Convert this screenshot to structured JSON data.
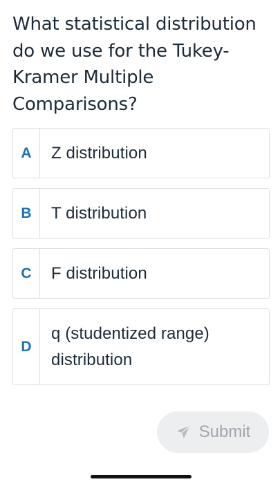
{
  "question": {
    "text": "What statistical distribution do we use for the Tukey-Kramer Multiple Comparisons?"
  },
  "options": [
    {
      "letter": "A",
      "text": "Z distribution"
    },
    {
      "letter": "B",
      "text": "T distribution"
    },
    {
      "letter": "C",
      "text": "F distribution"
    },
    {
      "letter": "D",
      "text": "q (studentized range) distribution"
    }
  ],
  "submit": {
    "label": "Submit",
    "icon": "paper-plane-icon",
    "state": "disabled"
  },
  "colors": {
    "letter_accent": "#1f6fb0",
    "submit_bg": "#eceef0",
    "submit_text": "#9fa6ad",
    "border": "#dcdfe3"
  }
}
